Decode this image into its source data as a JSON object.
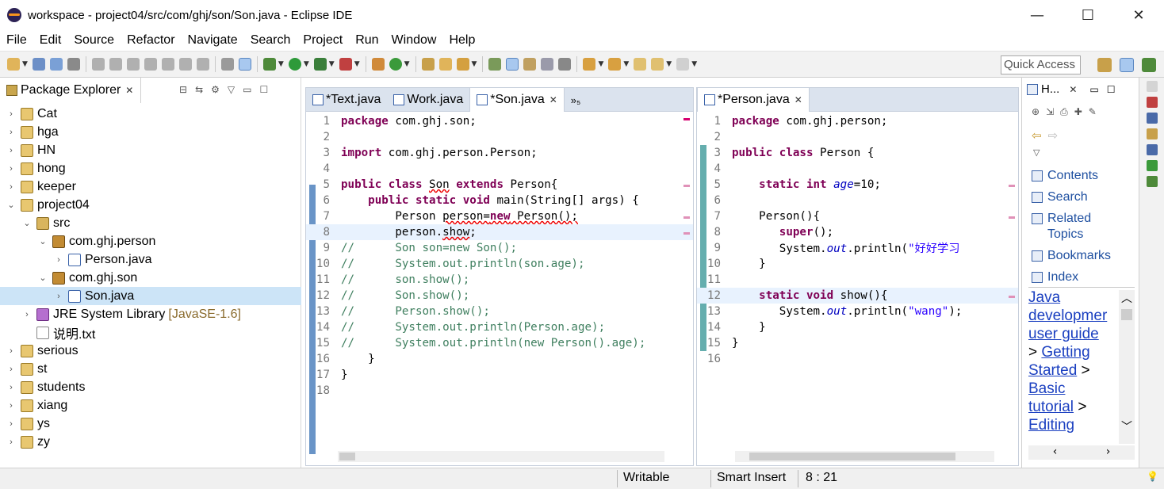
{
  "window": {
    "title": "workspace - project04/src/com/ghj/son/Son.java - Eclipse IDE",
    "minimize": "—",
    "maximize": "☐",
    "close": "✕"
  },
  "menu": [
    "File",
    "Edit",
    "Source",
    "Refactor",
    "Navigate",
    "Search",
    "Project",
    "Run",
    "Window",
    "Help"
  ],
  "toolbar": {
    "quick_access_placeholder": "Quick Access"
  },
  "package_explorer": {
    "title": "Package Explorer",
    "close": "✕",
    "tree": [
      {
        "label": "Cat",
        "twisty": "›",
        "icon": "project",
        "level": 0
      },
      {
        "label": "hga",
        "twisty": "›",
        "icon": "project",
        "level": 0
      },
      {
        "label": "HN",
        "twisty": "›",
        "icon": "project",
        "level": 0
      },
      {
        "label": "hong",
        "twisty": "›",
        "icon": "project",
        "level": 0
      },
      {
        "label": "keeper",
        "twisty": "›",
        "icon": "project",
        "level": 0
      },
      {
        "label": "project04",
        "twisty": "⌄",
        "icon": "project",
        "level": 0
      },
      {
        "label": "src",
        "twisty": "⌄",
        "icon": "src",
        "level": 1
      },
      {
        "label": "com.ghj.person",
        "twisty": "⌄",
        "icon": "pkg",
        "level": 2
      },
      {
        "label": "Person.java",
        "twisty": "›",
        "icon": "java",
        "level": 3
      },
      {
        "label": "com.ghj.son",
        "twisty": "⌄",
        "icon": "pkg",
        "level": 2
      },
      {
        "label": "Son.java",
        "twisty": "›",
        "icon": "java",
        "level": 3,
        "selected": true
      },
      {
        "label": "JRE System Library",
        "extra": "[JavaSE-1.6]",
        "twisty": "›",
        "icon": "lib",
        "level": 1
      },
      {
        "label": "说明.txt",
        "twisty": "",
        "icon": "txt",
        "level": 1
      },
      {
        "label": "serious",
        "twisty": "›",
        "icon": "project",
        "level": 0
      },
      {
        "label": "st",
        "twisty": "›",
        "icon": "project",
        "level": 0
      },
      {
        "label": "students",
        "twisty": "›",
        "icon": "project",
        "level": 0
      },
      {
        "label": "xiang",
        "twisty": "›",
        "icon": "project",
        "level": 0
      },
      {
        "label": "ys",
        "twisty": "›",
        "icon": "project",
        "level": 0
      },
      {
        "label": "zy",
        "twisty": "›",
        "icon": "project",
        "level": 0
      }
    ]
  },
  "editor_left": {
    "tabs": [
      {
        "label": "*Text.java",
        "active": false
      },
      {
        "label": "Work.java",
        "active": false
      },
      {
        "label": "*Son.java",
        "active": true,
        "close": "✕"
      }
    ],
    "overflow": "»₅",
    "lines": [
      {
        "n": "1",
        "html": "<span class='kw'>package</span> com.ghj.son;"
      },
      {
        "n": "2",
        "html": ""
      },
      {
        "n": "3",
        "html": "<span class='kw'>import</span> com.ghj.person.Person;"
      },
      {
        "n": "4",
        "html": ""
      },
      {
        "n": "5",
        "html": "<span class='kw'>public class</span> <span class='err'>Son</span> <span class='kw'>extends</span> Person{"
      },
      {
        "n": "6",
        "html": "    <span class='kw'>public static void</span> main(String[] args) {"
      },
      {
        "n": "7",
        "html": "        Person <span class='err'>person=</span><span class='kw err'>new</span><span class='err'> Person();</span>"
      },
      {
        "n": "8",
        "html": "        person.<span class='err'>show</span>;",
        "hl": true
      },
      {
        "n": "9",
        "html": "<span class='cm'>//      Son son=new Son();</span>"
      },
      {
        "n": "10",
        "html": "<span class='cm'>//      System.out.println(son.age);</span>"
      },
      {
        "n": "11",
        "html": "<span class='cm'>//      son.show();</span>"
      },
      {
        "n": "12",
        "html": "<span class='cm'>//      Son.show();</span>"
      },
      {
        "n": "13",
        "html": "<span class='cm'>//      Person.show();</span>"
      },
      {
        "n": "14",
        "html": "<span class='cm'>//      System.out.println(Person.age);</span>"
      },
      {
        "n": "15",
        "html": "<span class='cm'>//      System.out.println(new Person().age);</span>"
      },
      {
        "n": "16",
        "html": "    }"
      },
      {
        "n": "17",
        "html": "}"
      },
      {
        "n": "18",
        "html": ""
      }
    ]
  },
  "editor_right": {
    "tabs": [
      {
        "label": "*Person.java",
        "active": true,
        "close": "✕"
      }
    ],
    "lines": [
      {
        "n": "1",
        "html": "<span class='kw'>package</span> com.ghj.person;"
      },
      {
        "n": "2",
        "html": ""
      },
      {
        "n": "3",
        "html": "<span class='kw'>public class</span> Person {"
      },
      {
        "n": "4",
        "html": ""
      },
      {
        "n": "5",
        "html": "    <span class='kw'>static int</span> <span class='fld'>age</span>=10;"
      },
      {
        "n": "6",
        "html": ""
      },
      {
        "n": "7",
        "html": "    Person(){"
      },
      {
        "n": "8",
        "html": "       <span class='kw'>super</span>();"
      },
      {
        "n": "9",
        "html": "       System.<span class='fld'>out</span>.println(<span class='str'>\"好好学习</span>"
      },
      {
        "n": "10",
        "html": "    }"
      },
      {
        "n": "11",
        "html": ""
      },
      {
        "n": "12",
        "html": "    <span class='kw'>static void</span> show(){",
        "hl": true
      },
      {
        "n": "13",
        "html": "       System.<span class='fld'>out</span>.println(<span class='str'>\"wang\"</span>);"
      },
      {
        "n": "14",
        "html": "    }"
      },
      {
        "n": "15",
        "html": "}"
      },
      {
        "n": "16",
        "html": ""
      }
    ]
  },
  "help": {
    "tab_title": "H...",
    "close": "✕",
    "links": [
      "Contents",
      "Search",
      "Related",
      "Topics",
      "Bookmarks",
      "Index"
    ],
    "content": {
      "line1": "Java",
      "line2": "developmer",
      "line3": "user guide",
      "sep1": ">",
      "line4": "Getting",
      "line5": "Started",
      "sep2": ">",
      "line6": "Basic",
      "line7": "tutorial",
      "sep3": ">",
      "line8": "Editing"
    }
  },
  "status": {
    "mode": "Writable",
    "insert": "Smart Insert",
    "position": "8 : 21"
  },
  "colors": {
    "keyword": "#7f0055",
    "comment": "#3f7f5f",
    "string": "#2a00ff",
    "selection": "#cce4f7",
    "line_highlight": "#e8f2fe"
  }
}
